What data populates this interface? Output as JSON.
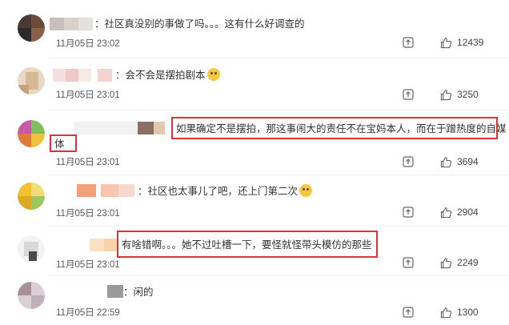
{
  "comments": [
    {
      "text": "：社区真没别的事做了吗。。。这有什么好调查的",
      "time": "11月05日 23:02",
      "likes": "12439"
    },
    {
      "text": "：会不会是摆拍剧本",
      "time": "11月05日 23:01",
      "likes": "3250"
    },
    {
      "text": "如果确定不是摆拍，那这事闹大的责任不在宝妈本人，而在于蹭热度的自媒",
      "text2": "体",
      "time": "11月05日 23:01",
      "likes": "3694"
    },
    {
      "text": "：社区也太事儿了吧，还上门第二次",
      "time": "11月05日 23:01",
      "likes": "2904"
    },
    {
      "text": "有啥错啊。。。她不过吐槽一下，要怪就怪带头模仿的那些",
      "time": "11月05日 23:01",
      "likes": "2249"
    },
    {
      "text": "：闲的",
      "time": "11月05日 22:59",
      "likes": "1300"
    }
  ],
  "icons": {
    "share": "share-icon",
    "like": "thumbs-up-icon",
    "emoji": "crying-face-emoji-icon"
  },
  "colors": {
    "highlight_box": "#e0303a",
    "text": "#333333",
    "meta": "#555555"
  }
}
